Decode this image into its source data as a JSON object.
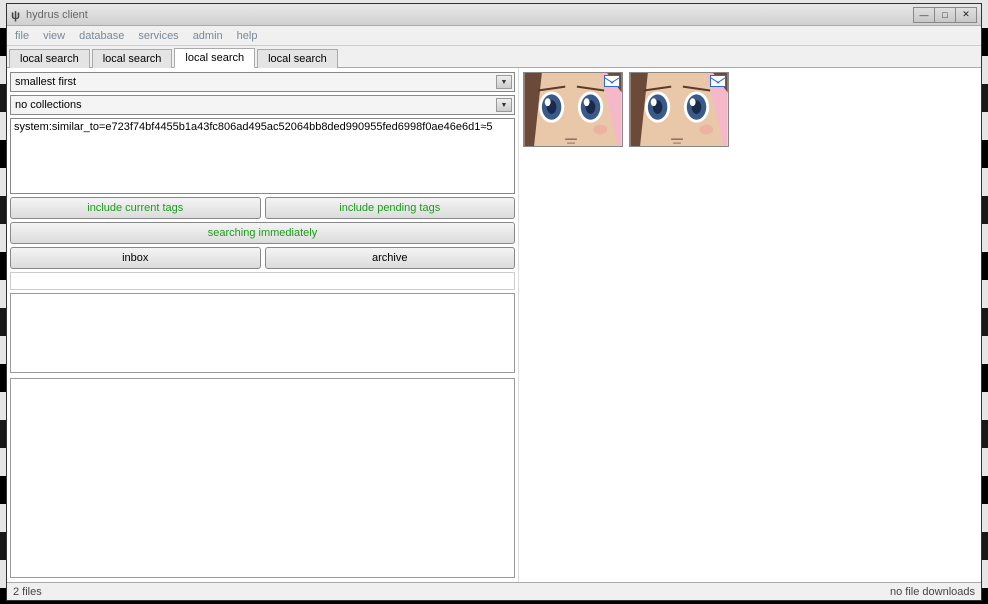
{
  "window": {
    "title": "hydrus client"
  },
  "menubar": [
    "file",
    "view",
    "database",
    "services",
    "admin",
    "help"
  ],
  "tabs": [
    {
      "label": "local search",
      "active": false
    },
    {
      "label": "local search",
      "active": false
    },
    {
      "label": "local search",
      "active": true
    },
    {
      "label": "local search",
      "active": false
    }
  ],
  "controls": {
    "sort": "smallest first",
    "collections": "no collections",
    "query": "system:similar_to=e723f74bf4455b1a43fc806ad495ac52064bb8ded990955fed6998f0ae46e6d1≈5",
    "include_current": "include current tags",
    "include_pending": "include pending tags",
    "searching": "searching immediately",
    "inbox": "inbox",
    "archive": "archive"
  },
  "thumbnails": [
    {
      "has_inbox_badge": true
    },
    {
      "has_inbox_badge": true
    }
  ],
  "statusbar": {
    "left": "2 files",
    "right": "no file downloads"
  },
  "colors": {
    "green": "#1a9c1a"
  }
}
